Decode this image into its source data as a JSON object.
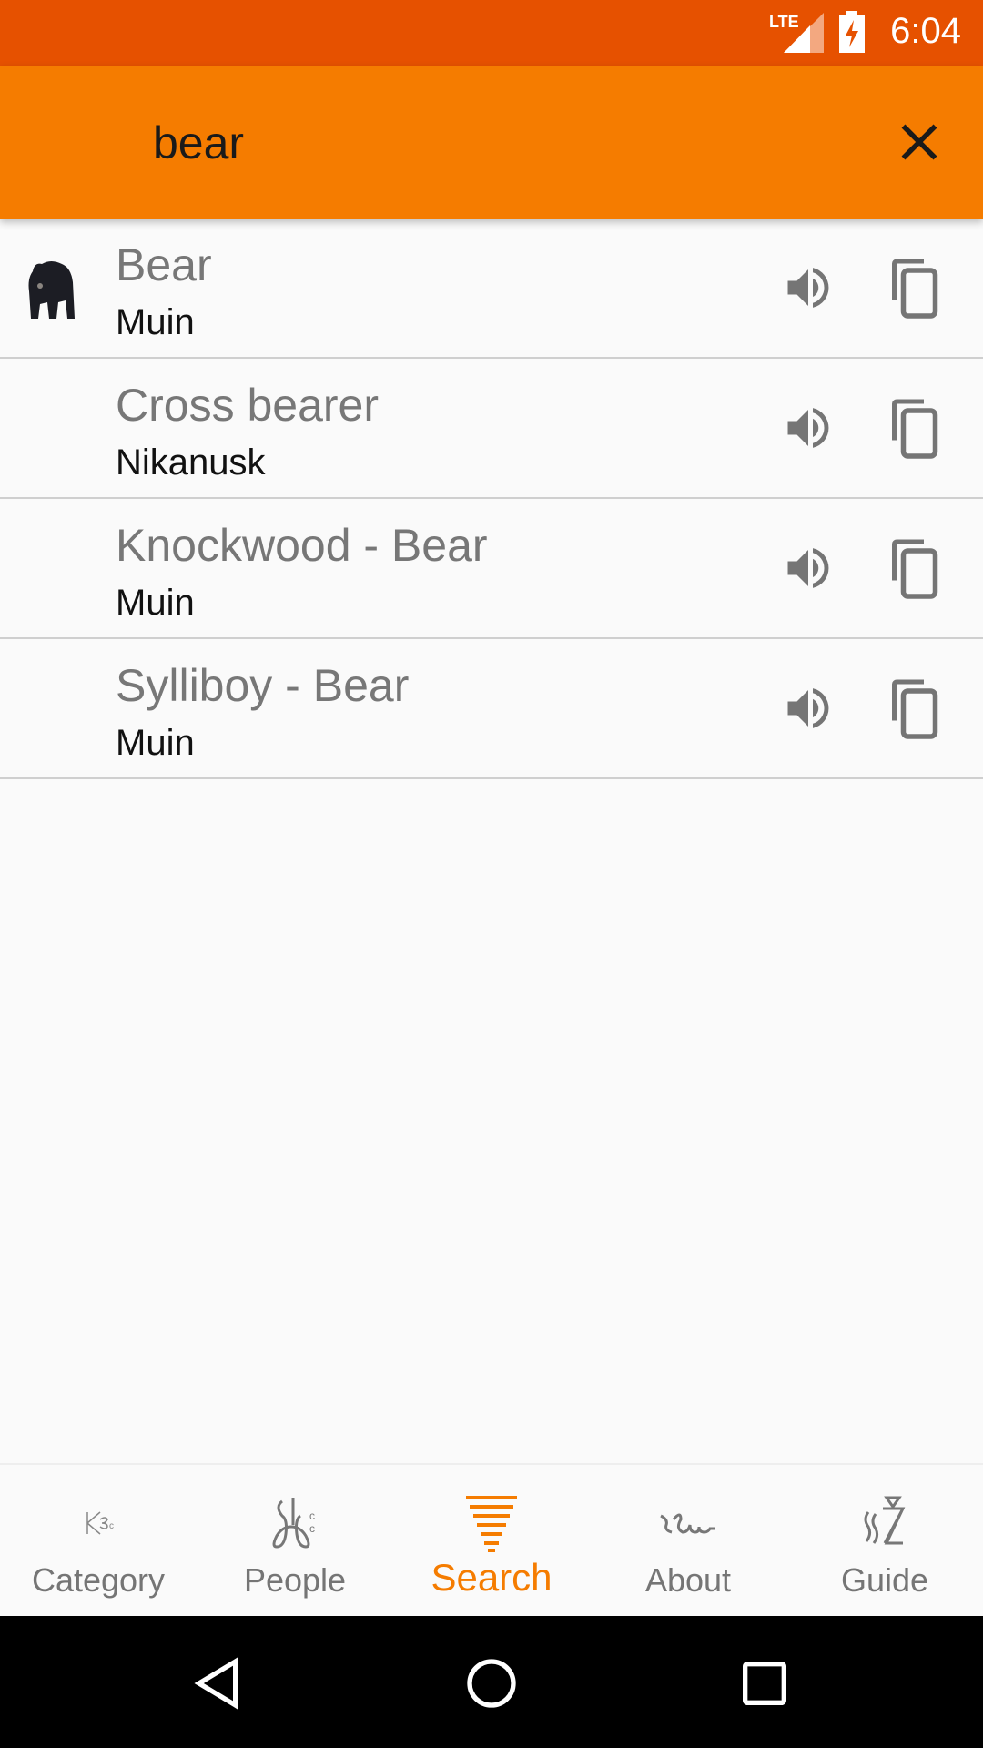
{
  "status_bar": {
    "network": "LTE",
    "time": "6:04",
    "icons": [
      "lte-signal-icon",
      "battery-charging-icon"
    ]
  },
  "search": {
    "query": "bear",
    "close_icon": "close-icon"
  },
  "results": [
    {
      "english": "Bear",
      "mikmaq": "Muin",
      "has_image": true
    },
    {
      "english": "Cross bearer",
      "mikmaq": "Nikanusk",
      "has_image": false
    },
    {
      "english": "Knockwood - Bear",
      "mikmaq": "Muin",
      "has_image": false
    },
    {
      "english": "Sylliboy - Bear",
      "mikmaq": "Muin",
      "has_image": false
    }
  ],
  "bottom_nav": {
    "active": "Search",
    "accent": "#f57c00",
    "items": [
      {
        "label": "Category"
      },
      {
        "label": "People"
      },
      {
        "label": "Search"
      },
      {
        "label": "About"
      },
      {
        "label": "Guide"
      }
    ]
  },
  "colors": {
    "status_bar": "#e65100",
    "toolbar": "#f57c00"
  }
}
